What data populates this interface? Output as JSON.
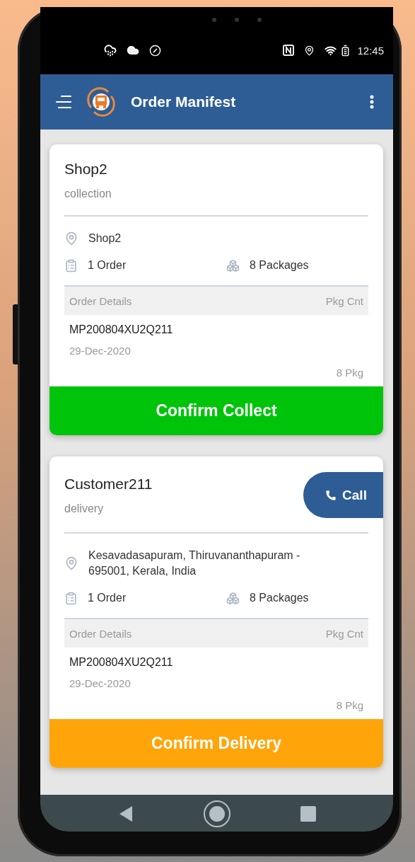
{
  "status_bar": {
    "time": "12:45"
  },
  "app_bar": {
    "title": "Order Manifest"
  },
  "stops": [
    {
      "name": "Shop2",
      "type": "collection",
      "address": "Shop2",
      "orders": "1 Order",
      "packages": "8 Packages",
      "table": {
        "columns": [
          "Order Details",
          "Pkg Cnt"
        ],
        "rows": [
          {
            "order_id": "MP200804XU2Q211",
            "date": "29-Dec-2020",
            "count": "8 Pkg"
          }
        ]
      },
      "action": {
        "label": "Confirm Collect",
        "color": "#00c40a"
      }
    },
    {
      "name": "Customer211",
      "type": "delivery",
      "call": {
        "label": "Call"
      },
      "address": "Kesavadasapuram, Thiruvananthapuram - 695001, Kerala, India",
      "orders": "1 Order",
      "packages": "8 Packages",
      "table": {
        "columns": [
          "Order Details",
          "Pkg Cnt"
        ],
        "rows": [
          {
            "order_id": "MP200804XU2Q211",
            "date": "29-Dec-2020",
            "count": "8 Pkg"
          }
        ]
      },
      "action": {
        "label": "Confirm Delivery",
        "color": "#ffa50a"
      }
    }
  ]
}
